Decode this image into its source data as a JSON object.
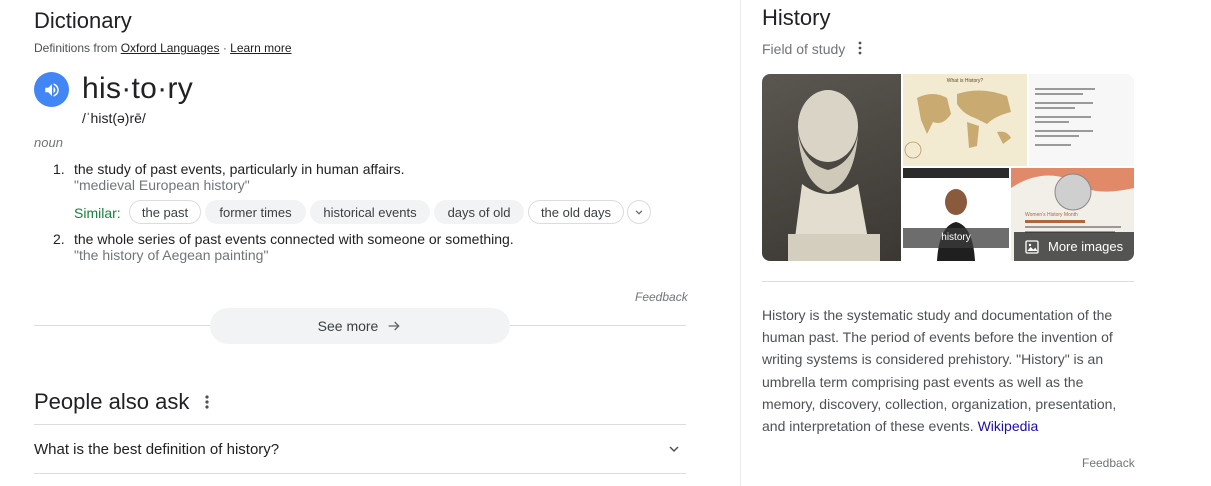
{
  "dictionary": {
    "title": "Dictionary",
    "source_prefix": "Definitions from",
    "source_link": "Oxford Languages",
    "source_sep": "·",
    "learn_more": "Learn more",
    "headword": "his·to·ry",
    "pronunciation": "/ˈhist(ə)rē/",
    "part_of_speech": "noun",
    "senses": [
      {
        "num": "1.",
        "definition": "the study of past events, particularly in human affairs.",
        "example": "\"medieval European history\""
      },
      {
        "num": "2.",
        "definition": "the whole series of past events connected with someone or something.",
        "example": "\"the history of Aegean painting\""
      }
    ],
    "similar_label": "Similar:",
    "similar": [
      "the past",
      "former times",
      "historical events",
      "days of old",
      "the old days"
    ],
    "feedback": "Feedback",
    "see_more": "See more"
  },
  "people_also_ask": {
    "title": "People also ask",
    "questions": [
      "What is the best definition of history?"
    ]
  },
  "knowledge_panel": {
    "title": "History",
    "subtitle": "Field of study",
    "more_images": "More images",
    "video_label": "history",
    "map_caption": "What is History?",
    "womens_caption": "Women's History Month",
    "description": "History is the systematic study and documentation of the human past. The period of events before the invention of writing systems is considered prehistory. \"History\" is an umbrella term comprising past events as well as the memory, discovery, collection, organization, presentation, and interpretation of these events.",
    "source": "Wikipedia",
    "feedback": "Feedback"
  },
  "colors": {
    "speaker_blue": "#4285f4",
    "similar_green": "#188038",
    "link_blue": "#1a0dab"
  },
  "icons": [
    "speaker-icon",
    "chevron-down-icon",
    "arrow-right-icon",
    "more-vert-icon",
    "image-icon"
  ]
}
